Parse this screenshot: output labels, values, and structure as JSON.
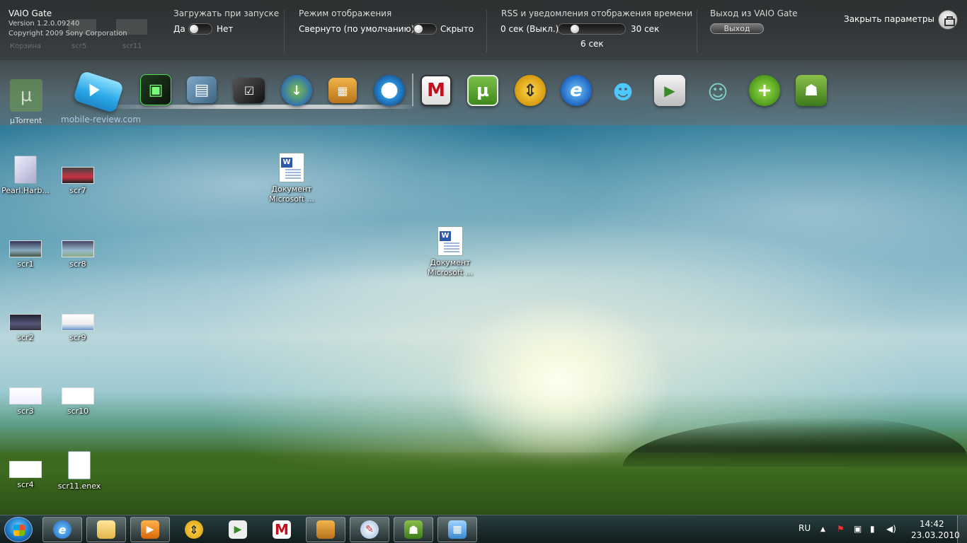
{
  "app": {
    "title": "VAIO Gate",
    "version": "Version 1.2.0.09240",
    "copyright": "Copyright 2009 Sony Corporation"
  },
  "ghost_labels": {
    "recycle": "Корзина",
    "scr5": "scr5",
    "scr11": "scr11"
  },
  "settings": {
    "autostart": {
      "heading": "Загружать при запуске",
      "on_label": "Да",
      "off_label": "Нет"
    },
    "display_mode": {
      "heading": "Режим отображения",
      "on_label": "Свернуто (по умолчанию)",
      "off_label": "Скрыто"
    },
    "rss": {
      "heading": "RSS и уведомления отображения времени",
      "min_label": "0 сек (Выкл.)",
      "max_label": "30 сек",
      "current": "6 сек"
    },
    "exit": {
      "heading": "Выход из VAIO Gate",
      "button": "Выход"
    },
    "close_params": "Закрыть параметры"
  },
  "dock": {
    "watermark": "mobile-review.com",
    "utorrent_label": "µTorrent",
    "icons": [
      "vaio-gate",
      "media-gallery",
      "photo-viewer",
      "vaio-notebook",
      "web-download",
      "package",
      "sync",
      "mcafee",
      "utorrent",
      "bittorrent-arrows",
      "internet-explorer",
      "messenger",
      "media-center",
      "contacts",
      "add-item",
      "evernote"
    ]
  },
  "desktop": [
    {
      "label": "Pearl.Harb...",
      "kind": "video"
    },
    {
      "label": "scr7",
      "kind": "thumb"
    },
    {
      "label": "scr1",
      "kind": "thumb"
    },
    {
      "label": "scr8",
      "kind": "thumb"
    },
    {
      "label": "scr2",
      "kind": "thumb"
    },
    {
      "label": "scr9",
      "kind": "thumb"
    },
    {
      "label": "scr3",
      "kind": "thumb"
    },
    {
      "label": "scr10",
      "kind": "thumb"
    },
    {
      "label": "scr4",
      "kind": "thumb"
    },
    {
      "label": "scr11.enex",
      "kind": "file"
    },
    {
      "label1": "Документ",
      "label2": "Microsoft ...",
      "kind": "word"
    },
    {
      "label1": "Документ",
      "label2": "Microsoft ...",
      "kind": "word"
    }
  ],
  "taskbar": {
    "pinned": [
      "internet-explorer",
      "explorer",
      "media-player",
      "bittorrent",
      "media-center",
      "mcafee",
      "package",
      "paint",
      "evernote",
      "control-panel"
    ],
    "tray": {
      "language": "RU",
      "time": "14:42",
      "date": "23.03.2010"
    }
  },
  "colors": {
    "accent": "#2aa8e8",
    "bar_bg": "#3a3a3a"
  }
}
